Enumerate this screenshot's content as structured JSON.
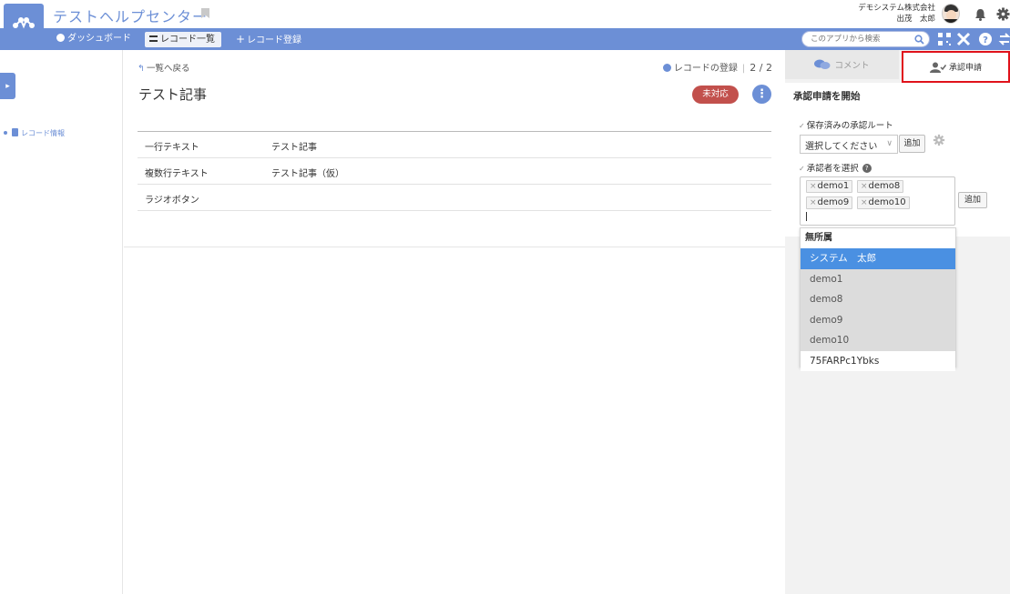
{
  "header": {
    "app_title": "テストヘルプセンター",
    "company": "デモシステム株式会社",
    "user_name": "出茂　太郎"
  },
  "nav": {
    "dashboard": "ダッシュボード",
    "record_list": "レコード一覧",
    "add_record": "レコード登録",
    "search_placeholder": "このアプリから検索"
  },
  "sidebar": {
    "record_info": "レコード情報"
  },
  "record": {
    "back_label": "一覧へ戻る",
    "register_label": "レコードの登録",
    "pager": "2 / 2",
    "title": "テスト記事",
    "status": "未対応",
    "fields": [
      {
        "label": "一行テキスト",
        "value": "テスト記事"
      },
      {
        "label": "複数行テキスト",
        "value": "テスト記事（仮）"
      },
      {
        "label": "ラジオボタン",
        "value": ""
      }
    ]
  },
  "panel": {
    "tab_comment": "コメント",
    "tab_approval": "承認申請",
    "heading": "承認申請を開始",
    "saved_routes_label": "保存済みの承認ルート",
    "route_select_value": "選択してください",
    "route_add": "追加",
    "approver_label": "承認者を選択",
    "approvers": [
      "demo1",
      "demo8",
      "demo9",
      "demo10"
    ],
    "approver_add": "追加"
  },
  "dropdown": {
    "group": "無所属",
    "options": [
      "システム　太郎",
      "demo1",
      "demo8",
      "demo9",
      "demo10",
      "75FARPc1Ybks"
    ],
    "selected": "システム　太郎"
  },
  "colors": {
    "brand": "#6c8fd6",
    "status_badge": "#c2504c",
    "highlight_border": "#e0121b",
    "selected_option": "#4a90e2"
  }
}
